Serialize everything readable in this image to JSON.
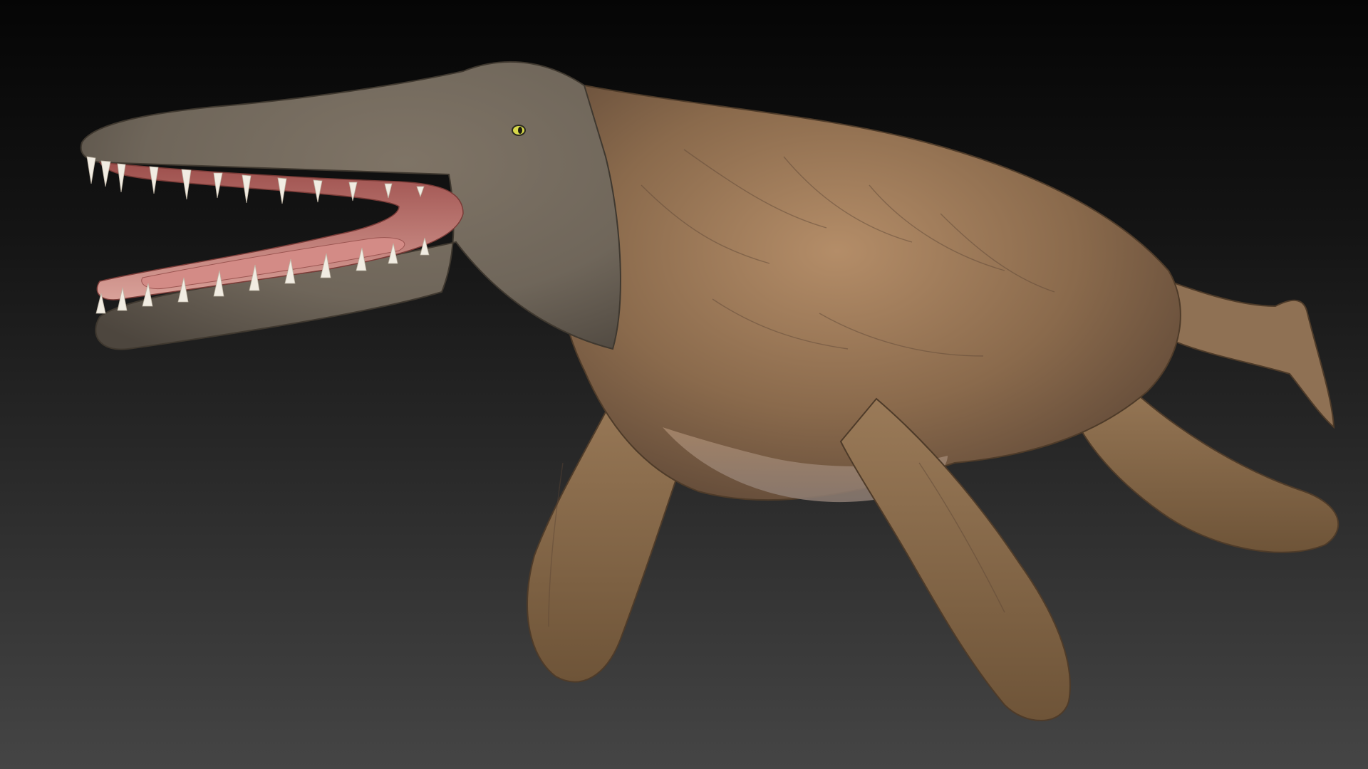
{
  "scene": {
    "subject_icon": "marine-reptile-icon",
    "colors": {
      "background_top": "#050505",
      "background_bottom": "#454545",
      "skin_base": "#8a6a4c",
      "skin_light": "#b48d68",
      "skin_dark": "#5b4535",
      "head_grey": "#6f665a",
      "mouth_pink": "#c9827a",
      "gum_pink": "#d9a199",
      "teeth": "#f1ece2",
      "eye": "#d7d84a"
    }
  }
}
